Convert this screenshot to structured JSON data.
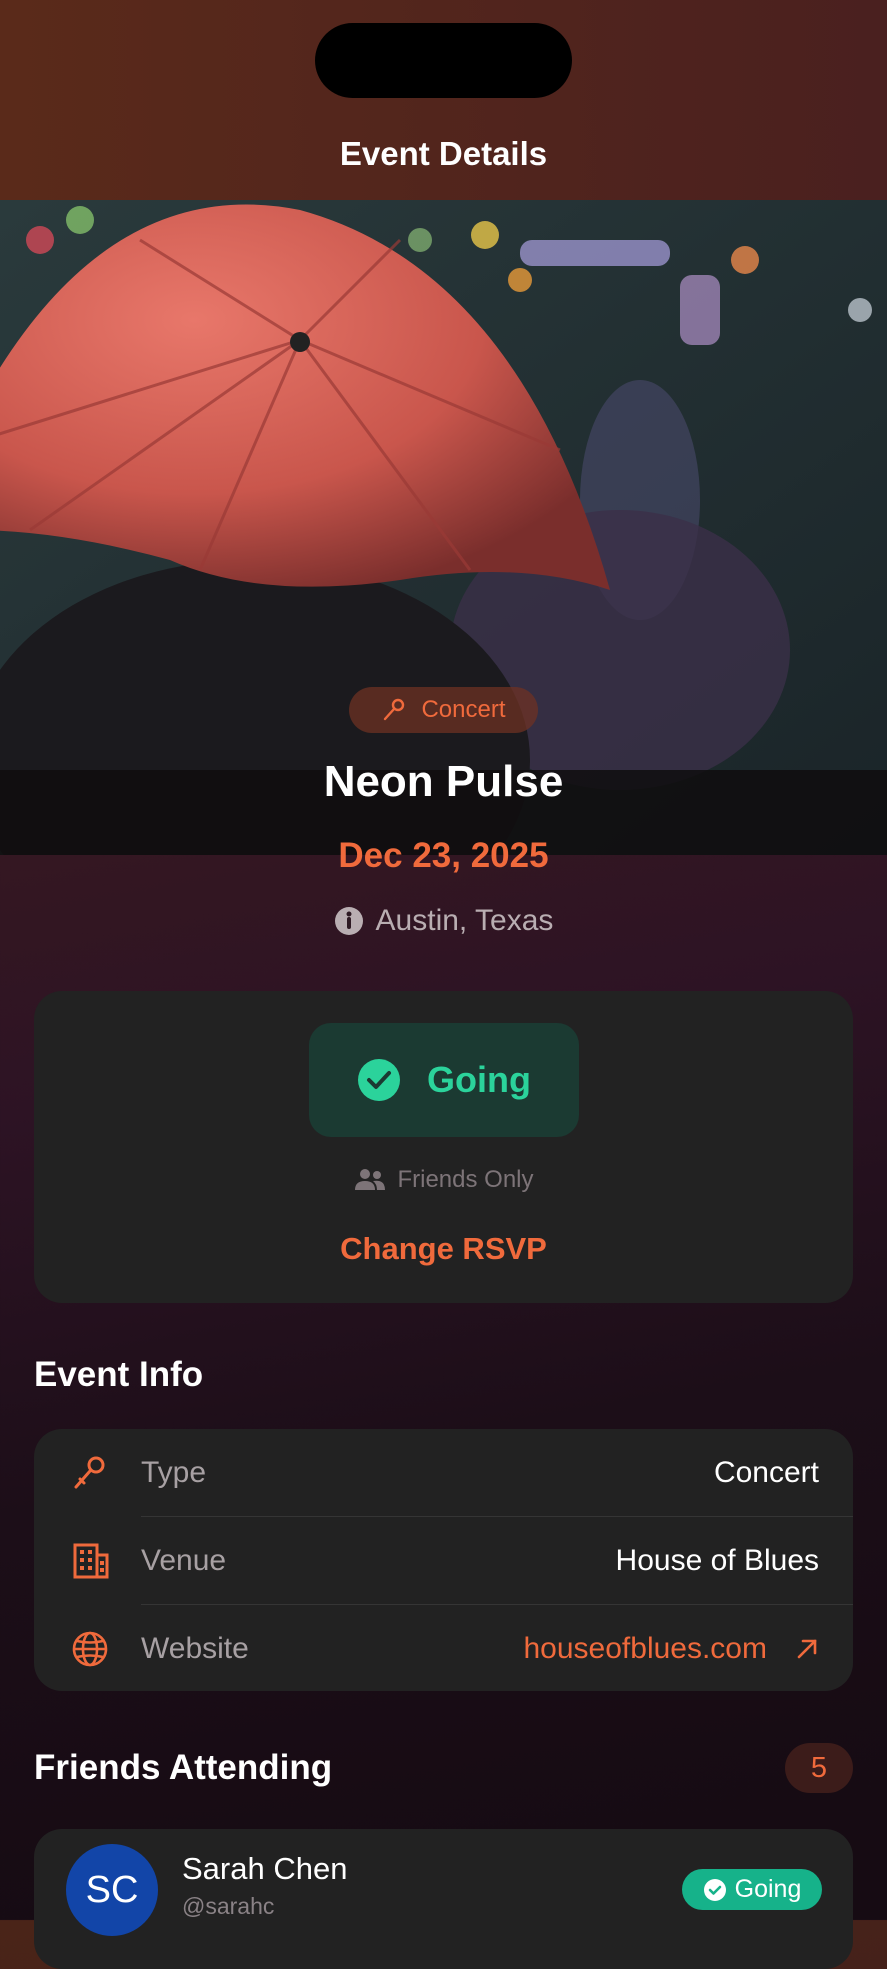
{
  "header": {
    "title": "Event Details"
  },
  "event": {
    "category": "Concert",
    "title": "Neon Pulse",
    "date": "Dec 23, 2025",
    "location": "Austin, Texas"
  },
  "rsvp": {
    "status": "Going",
    "visibility": "Friends Only",
    "change_label": "Change RSVP"
  },
  "info": {
    "title": "Event Info",
    "rows": [
      {
        "label": "Type",
        "value": "Concert",
        "icon": "microphone-icon"
      },
      {
        "label": "Venue",
        "value": "House of Blues",
        "icon": "building-icon"
      },
      {
        "label": "Website",
        "value": "houseofblues.com",
        "icon": "globe-icon"
      }
    ]
  },
  "friends": {
    "title": "Friends Attending",
    "count": "5",
    "items": [
      {
        "initials": "SC",
        "name": "Sarah Chen",
        "handle": "@sarahc",
        "status": "Going"
      }
    ]
  },
  "colors": {
    "accent": "#f06a3c",
    "going": "#2bd39b",
    "card": "#222222",
    "avatar": "#1245a8"
  }
}
